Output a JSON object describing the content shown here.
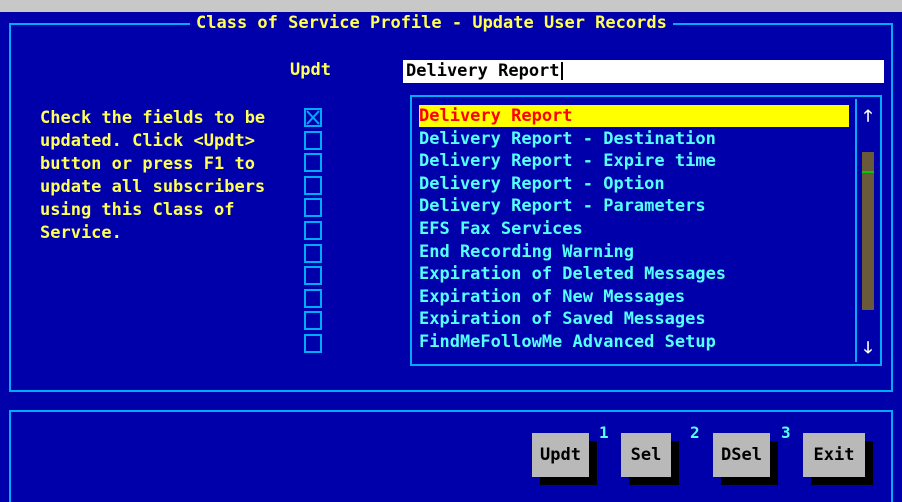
{
  "window": {
    "title": "Class of Service Profile - Update User Records"
  },
  "form": {
    "updt_label": "Updt",
    "field_value": "Delivery Report",
    "instructions": "Check the fields to be\nupdated. Click <Updt>\nbutton or press F1 to\nupdate all subscribers\nusing this Class of\nService."
  },
  "list": {
    "items": [
      {
        "label": "Delivery Report",
        "checked": true,
        "selected": true
      },
      {
        "label": "Delivery Report - Destination",
        "checked": false
      },
      {
        "label": "Delivery Report - Expire time",
        "checked": false
      },
      {
        "label": "Delivery Report - Option",
        "checked": false
      },
      {
        "label": "Delivery Report - Parameters",
        "checked": false
      },
      {
        "label": "EFS Fax Services",
        "checked": false
      },
      {
        "label": "End Recording Warning",
        "checked": false
      },
      {
        "label": "Expiration of Deleted Messages",
        "checked": false
      },
      {
        "label": "Expiration of New Messages",
        "checked": false
      },
      {
        "label": "Expiration of Saved Messages",
        "checked": false
      },
      {
        "label": "FindMeFollowMe Advanced Setup",
        "checked": false
      }
    ],
    "scroll_up_icon": "arrow-up",
    "scroll_down_icon": "arrow-down",
    "scroll_position": 0.1
  },
  "buttons": [
    {
      "label": "Updt",
      "hotkey": "1"
    },
    {
      "label": "Sel",
      "hotkey": "2"
    },
    {
      "label": "DSel",
      "hotkey": "3"
    },
    {
      "label": "Exit",
      "hotkey": ""
    }
  ],
  "colors": {
    "background": "#0000aa",
    "border": "#00aaff",
    "text": "#ffff55",
    "list_text": "#55ffff",
    "selection_bg": "#ffff00",
    "selection_text": "#ff0000",
    "button_bg": "#b9b9b9"
  }
}
